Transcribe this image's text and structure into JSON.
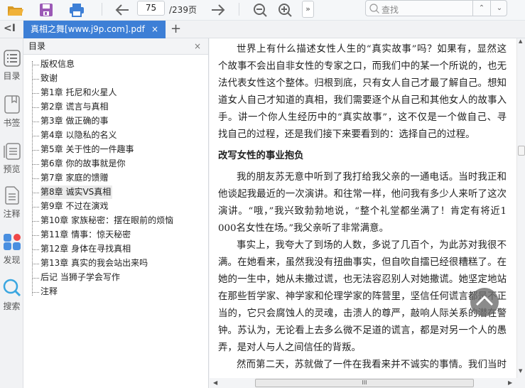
{
  "toolbar": {
    "icons": [
      "open-folder-icon",
      "save-icon",
      "print-icon",
      "arrow-left-icon",
      "arrow-right-icon",
      "zoom-out-icon",
      "zoom-in-icon"
    ],
    "page_current": "75",
    "page_total": "/239页",
    "more_label": "»",
    "search_placeholder": "查找",
    "search_prev": "⌃",
    "search_next": "⌄"
  },
  "tabbar": {
    "collapse_label": "<I",
    "tab_title": "真相之舞[www.j9p.com].pdf",
    "tab_close": "×",
    "new_tab": "+"
  },
  "rail": {
    "items": [
      {
        "label": "目录"
      },
      {
        "label": "书签"
      },
      {
        "label": "预览"
      },
      {
        "label": "注释"
      },
      {
        "label": "发现"
      },
      {
        "label": "搜索"
      }
    ]
  },
  "toc": {
    "title": "目录",
    "close": "×",
    "selected_index": 9,
    "items": [
      "版权信息",
      "致谢",
      "第1章 托尼和火星人",
      "第2章 谎言与真相",
      "第3章 做正确的事",
      "第4章 以隐私的名义",
      "第5章 关于性的一件趣事",
      "第6章 你的故事就是你",
      "第7章 家庭的馈赠",
      "第8章 诚实VS真相",
      "第9章 不过在演戏",
      "第10章 家族秘密：摆在眼前的烦恼",
      "第11章 情事：惊天秘密",
      "第12章 身体在寻找真相",
      "第13章 真实的我会站出来吗",
      "后记 当狮子学会写作",
      "注释"
    ]
  },
  "document": {
    "lines": [
      {
        "t": "世界上有什么描述女性人生的“真实故事”吗？如果有，显然这",
        "k": "first"
      },
      {
        "t": "个故事不会出自非女性的专家之口，而我们中的某一个所说的，也无",
        "k": ""
      },
      {
        "t": "法代表女性这个整体。归根到底，只有女人自己才最了解自己。想知",
        "k": ""
      },
      {
        "t": "道女人自己才知道的真相，我们需要逐个从自己和其他女人的故事入",
        "k": ""
      },
      {
        "t": "手。讲一个你人生经历中的“真实故事”，这不仅是一个做自己、寻",
        "k": ""
      },
      {
        "t": "找自己的过程，还是我们接下来要看到的：选择自己的过程。",
        "k": "last"
      },
      {
        "t": "改写女性的事业抱负",
        "k": "heading"
      },
      {
        "t": "我的朋友苏无意中听到了我打给我父亲的一通电话。当时我正和",
        "k": "first"
      },
      {
        "t": "他谈起我最近的一次演讲。和往常一样，他问我有多少人来听了这次",
        "k": ""
      },
      {
        "t": "演讲。“哦，”我兴致勃勃地说，“整个礼堂都坐满了！肯定有将近1",
        "k": ""
      },
      {
        "t": "000名女性在场。”我父亲听了非常满意。",
        "k": "last"
      },
      {
        "t": "事实上，我夸大了到场的人数，多说了几百个，为此苏对我很不",
        "k": "first"
      },
      {
        "t": "满。在她看来，虽然我没有扭曲事实，但自吹自擂已经很糟糕了。在",
        "k": ""
      },
      {
        "t": "她的一生中，她从未撒过谎，也无法容忍别人对她撒谎。她坚定地站",
        "k": ""
      },
      {
        "t": "在那些哲学家、神学家和伦理学家的阵营里，坚信任何谎言都是不正",
        "k": ""
      },
      {
        "t": "当的，它只会腐蚀人的灵魂，击溃人的尊严，敲响人际关系的潜在警",
        "k": ""
      },
      {
        "t": "钟。苏认为，无论看上去多么微不足道的谎言，都是对另一个人的愚",
        "k": ""
      },
      {
        "t": "弄，是对人与人之间信任的背叛。",
        "k": "last"
      },
      {
        "t": "然而第二天，苏就做了一件在我看来并不诚实的事情。我们当时",
        "k": "first"
      }
    ]
  },
  "scrollbar": {
    "hthumb_label": "III"
  },
  "colors": {
    "accent": "#3d7fd6",
    "folder": "#e8a530",
    "save": "#9b59b6",
    "print": "#3d7fd6"
  }
}
